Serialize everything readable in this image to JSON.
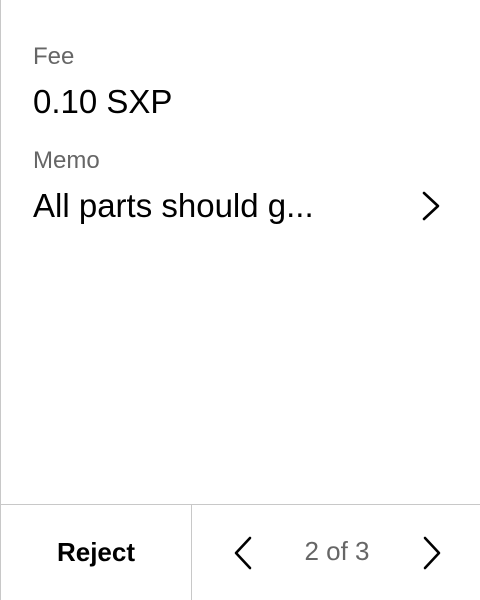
{
  "fields": {
    "fee": {
      "label": "Fee",
      "value": "0.10 SXP"
    },
    "memo": {
      "label": "Memo",
      "value": "All parts should g..."
    }
  },
  "footer": {
    "reject_label": "Reject",
    "pager_text": "2 of 3"
  },
  "icons": {
    "memo_expand": "chevron-right-icon",
    "pager_previous": "chevron-left-icon",
    "pager_next": "chevron-right-icon"
  },
  "colors": {
    "background": "#ffffff",
    "text_primary": "#000000",
    "text_secondary": "#666666",
    "divider": "#c8c8c8"
  }
}
